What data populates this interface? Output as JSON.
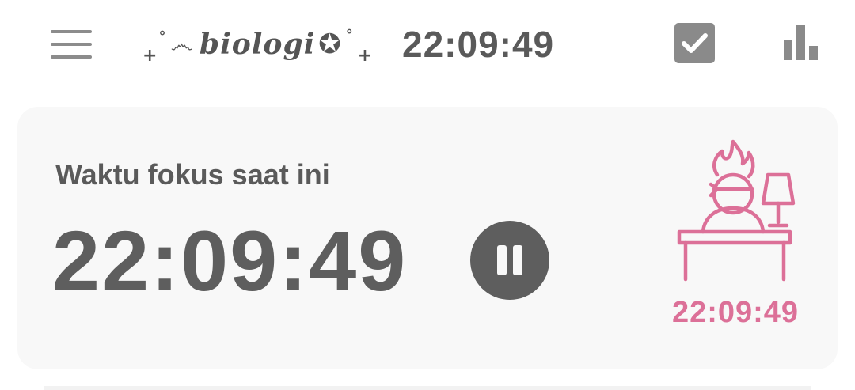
{
  "header": {
    "menu_icon": "hamburger-menu-icon",
    "subject": {
      "prefix": "+",
      "ring": "°",
      "spiral": "෴",
      "name": "biologi",
      "star": "✪",
      "ring2": "°",
      "suffix": "+"
    },
    "clock": "22:09:49",
    "check_icon": "checkbox-checked-icon",
    "stats_icon": "bar-chart-icon"
  },
  "focus_card": {
    "label": "Waktu fokus saat ini",
    "time": "22:09:49",
    "pause_icon": "pause-icon",
    "illustration": "person-studying-on-fire-icon",
    "secondary_time": "22:09:49"
  },
  "colors": {
    "text_gray": "#5e5e5e",
    "icon_gray": "#8a8a8a",
    "accent_pink": "#dc7098",
    "card_bg": "#f8f8f8"
  }
}
